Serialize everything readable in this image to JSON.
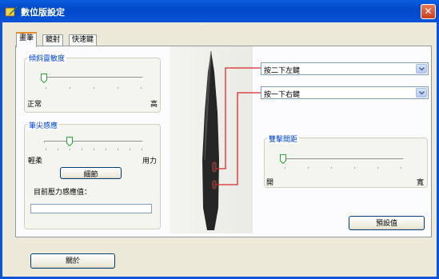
{
  "window": {
    "title": "數位版設定",
    "close_glyph": "✕",
    "title_icon": "pen-tablet-icon",
    "accent_color": "#0a54d8"
  },
  "tabs": [
    {
      "label": "畫筆",
      "active": true
    },
    {
      "label": "鏡射",
      "active": false
    },
    {
      "label": "快速鍵",
      "active": false
    }
  ],
  "tilt": {
    "label": "傾斜靈敏度",
    "min_label": "正常",
    "max_label": "高",
    "value": 0.0
  },
  "tip": {
    "label": "筆尖感應",
    "min_label": "輕柔",
    "max_label": "用力",
    "value": 0.25,
    "details_button": "細節",
    "pressure_label": "目前壓力感應值：",
    "pressure_value": 0
  },
  "buttons": {
    "upper_select": "按二下左鍵",
    "lower_select": "按一下右鍵"
  },
  "double_click": {
    "label": "雙擊間距",
    "min_label": "開",
    "max_label": "寬",
    "value": 0.0
  },
  "defaults_button": "預設值",
  "about_button": "關於"
}
